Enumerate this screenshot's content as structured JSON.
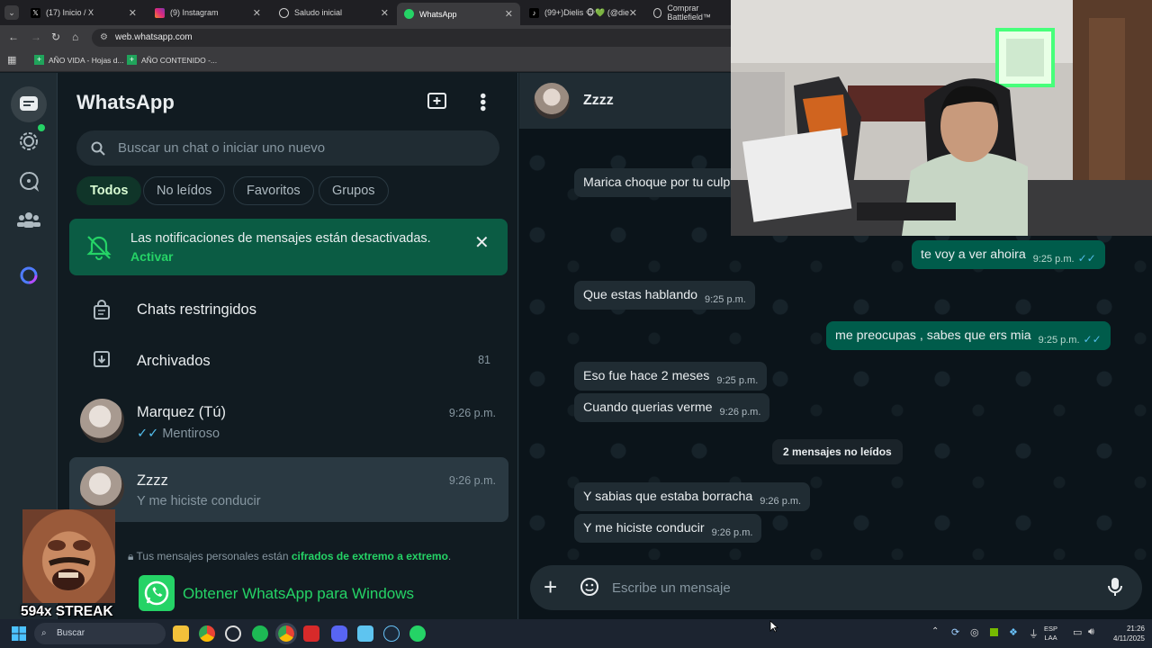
{
  "browser": {
    "tabs": [
      {
        "label": "(17) Inicio / X",
        "icon": "x-logo-icon"
      },
      {
        "label": "(9) Instagram",
        "icon": "instagram-icon"
      },
      {
        "label": "Saludo inicial",
        "icon": "chatgpt-icon"
      },
      {
        "label": "WhatsApp",
        "icon": "whatsapp-icon"
      },
      {
        "label": "(99+)Dielis 🐵💚 (@die",
        "icon": "tiktok-icon"
      },
      {
        "label": "Comprar Battlefield™",
        "icon": "ea-icon"
      }
    ],
    "url": "web.whatsapp.com",
    "bookmarks": [
      "AÑO VIDA - Hojas d...",
      "AÑO CONTENIDO -..."
    ]
  },
  "sidebar": {
    "title": "WhatsApp",
    "search_placeholder": "Buscar un chat o iniciar uno nuevo",
    "filters": [
      "Todos",
      "No leídos",
      "Favoritos",
      "Grupos"
    ],
    "notification": {
      "text": "Las notificaciones de mensajes están desactivadas.",
      "link": "Activar"
    },
    "restricted_label": "Chats restringidos",
    "archived_label": "Archivados",
    "archived_count": "81",
    "chats": [
      {
        "name": "Marquez (Tú)",
        "time": "9:26 p.m.",
        "preview": "Mentiroso"
      },
      {
        "name": "Zzzz",
        "time": "9:26 p.m.",
        "preview": "Y me hiciste conducir"
      }
    ],
    "encryption_prefix": "Tus mensajes personales están",
    "encryption_link": "cifrados de extremo a extremo",
    "encryption_suffix": ".",
    "get_windows": "Obtener WhatsApp para Windows"
  },
  "conversation": {
    "contact_name": "Zzzz",
    "messages": [
      {
        "dir": "in",
        "text": "Marica choque por tu culp",
        "time": ""
      },
      {
        "dir": "out",
        "text": "te voy a ver ahoira",
        "time": "9:25 p.m."
      },
      {
        "dir": "in",
        "text": "Que estas hablando",
        "time": "9:25 p.m."
      },
      {
        "dir": "out",
        "text": "me preocupas , sabes que ers mia",
        "time": "9:25 p.m."
      },
      {
        "dir": "in",
        "text": "Eso fue hace 2 meses",
        "time": "9:25 p.m."
      },
      {
        "dir": "in",
        "text": "Cuando querias verme",
        "time": "9:26 p.m."
      },
      {
        "dir": "in",
        "text": "Y sabias que estaba borracha",
        "time": "9:26 p.m."
      },
      {
        "dir": "in",
        "text": "Y me hiciste conducir",
        "time": "9:26 p.m."
      }
    ],
    "unread_divider": "2 mensajes no leídos",
    "composer_placeholder": "Escribe un mensaje"
  },
  "overlay": {
    "streak": "594x STREAK"
  },
  "taskbar": {
    "search_label": "Buscar",
    "lang_line1": "ESP",
    "lang_line2": "LAA",
    "time": "21:26",
    "date": "4/11/2025"
  },
  "colors": {
    "accent": "#25d366",
    "panel": "#111b21",
    "bubble_out": "#005c4b",
    "bubble_in": "#202c33"
  }
}
